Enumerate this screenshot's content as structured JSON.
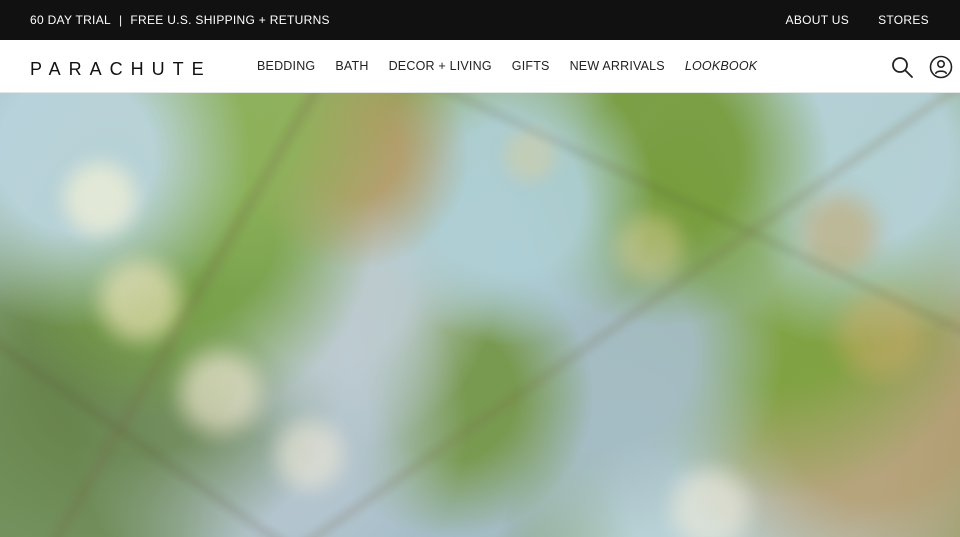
{
  "announcement": {
    "trial": "60 DAY TRIAL",
    "separator": "|",
    "shipping": "FREE U.S. SHIPPING + RETURNS",
    "links": [
      {
        "label": "ABOUT US"
      },
      {
        "label": "STORES"
      }
    ]
  },
  "header": {
    "logo_text": "PARACHUTE",
    "nav": [
      {
        "label": "BEDDING"
      },
      {
        "label": "BATH"
      },
      {
        "label": "DECOR + LIVING"
      },
      {
        "label": "GIFTS"
      },
      {
        "label": "NEW ARRIVALS"
      },
      {
        "label": "LOOKBOOK"
      }
    ],
    "icons": [
      {
        "name": "search-icon"
      },
      {
        "name": "account-icon"
      }
    ]
  },
  "colors": {
    "topbar_bg": "#111111",
    "text_dark": "#222222",
    "page_bg": "#ffffff"
  }
}
